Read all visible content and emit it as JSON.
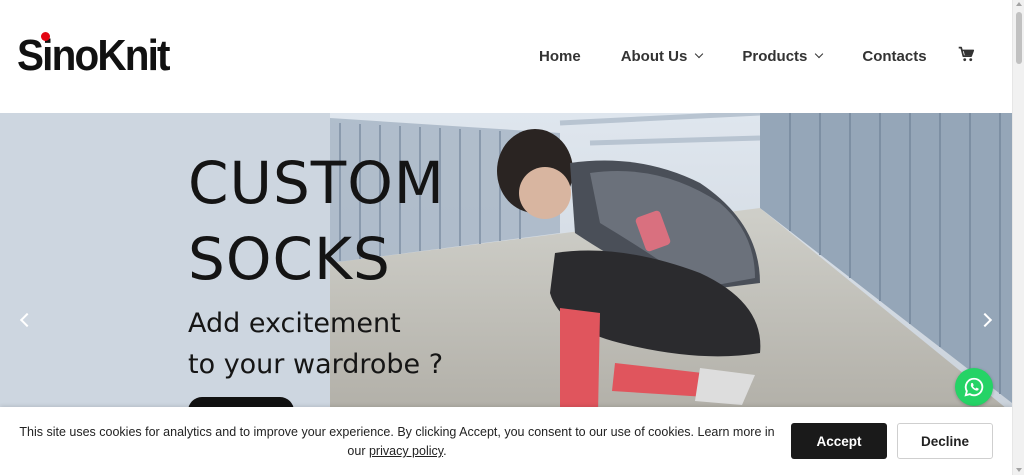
{
  "header": {
    "logo": "SinoKnit",
    "nav": [
      {
        "label": "Home",
        "has_dropdown": false
      },
      {
        "label": "About Us",
        "has_dropdown": true
      },
      {
        "label": "Products",
        "has_dropdown": true
      },
      {
        "label": "Contacts",
        "has_dropdown": false
      }
    ],
    "cart_icon": "cart-icon"
  },
  "hero": {
    "title_line1": "CUSTOM",
    "title_line2": "SOCKS",
    "subtitle_line1": "Add excitement",
    "subtitle_line2": "to your wardrobe ?",
    "prev_icon": "chevron-left-icon",
    "next_icon": "chevron-right-icon"
  },
  "whatsapp": {
    "icon": "whatsapp-icon",
    "color": "#25d366"
  },
  "cookie_banner": {
    "text": "This site uses cookies for analytics and to improve your experience. By clicking Accept, you consent to our use of cookies. Learn more in our",
    "link_text": "privacy policy",
    "link_suffix": ".",
    "accept_label": "Accept",
    "decline_label": "Decline"
  },
  "colors": {
    "logo_dot": "#e30613",
    "accept_bg": "#1a1a1a"
  }
}
